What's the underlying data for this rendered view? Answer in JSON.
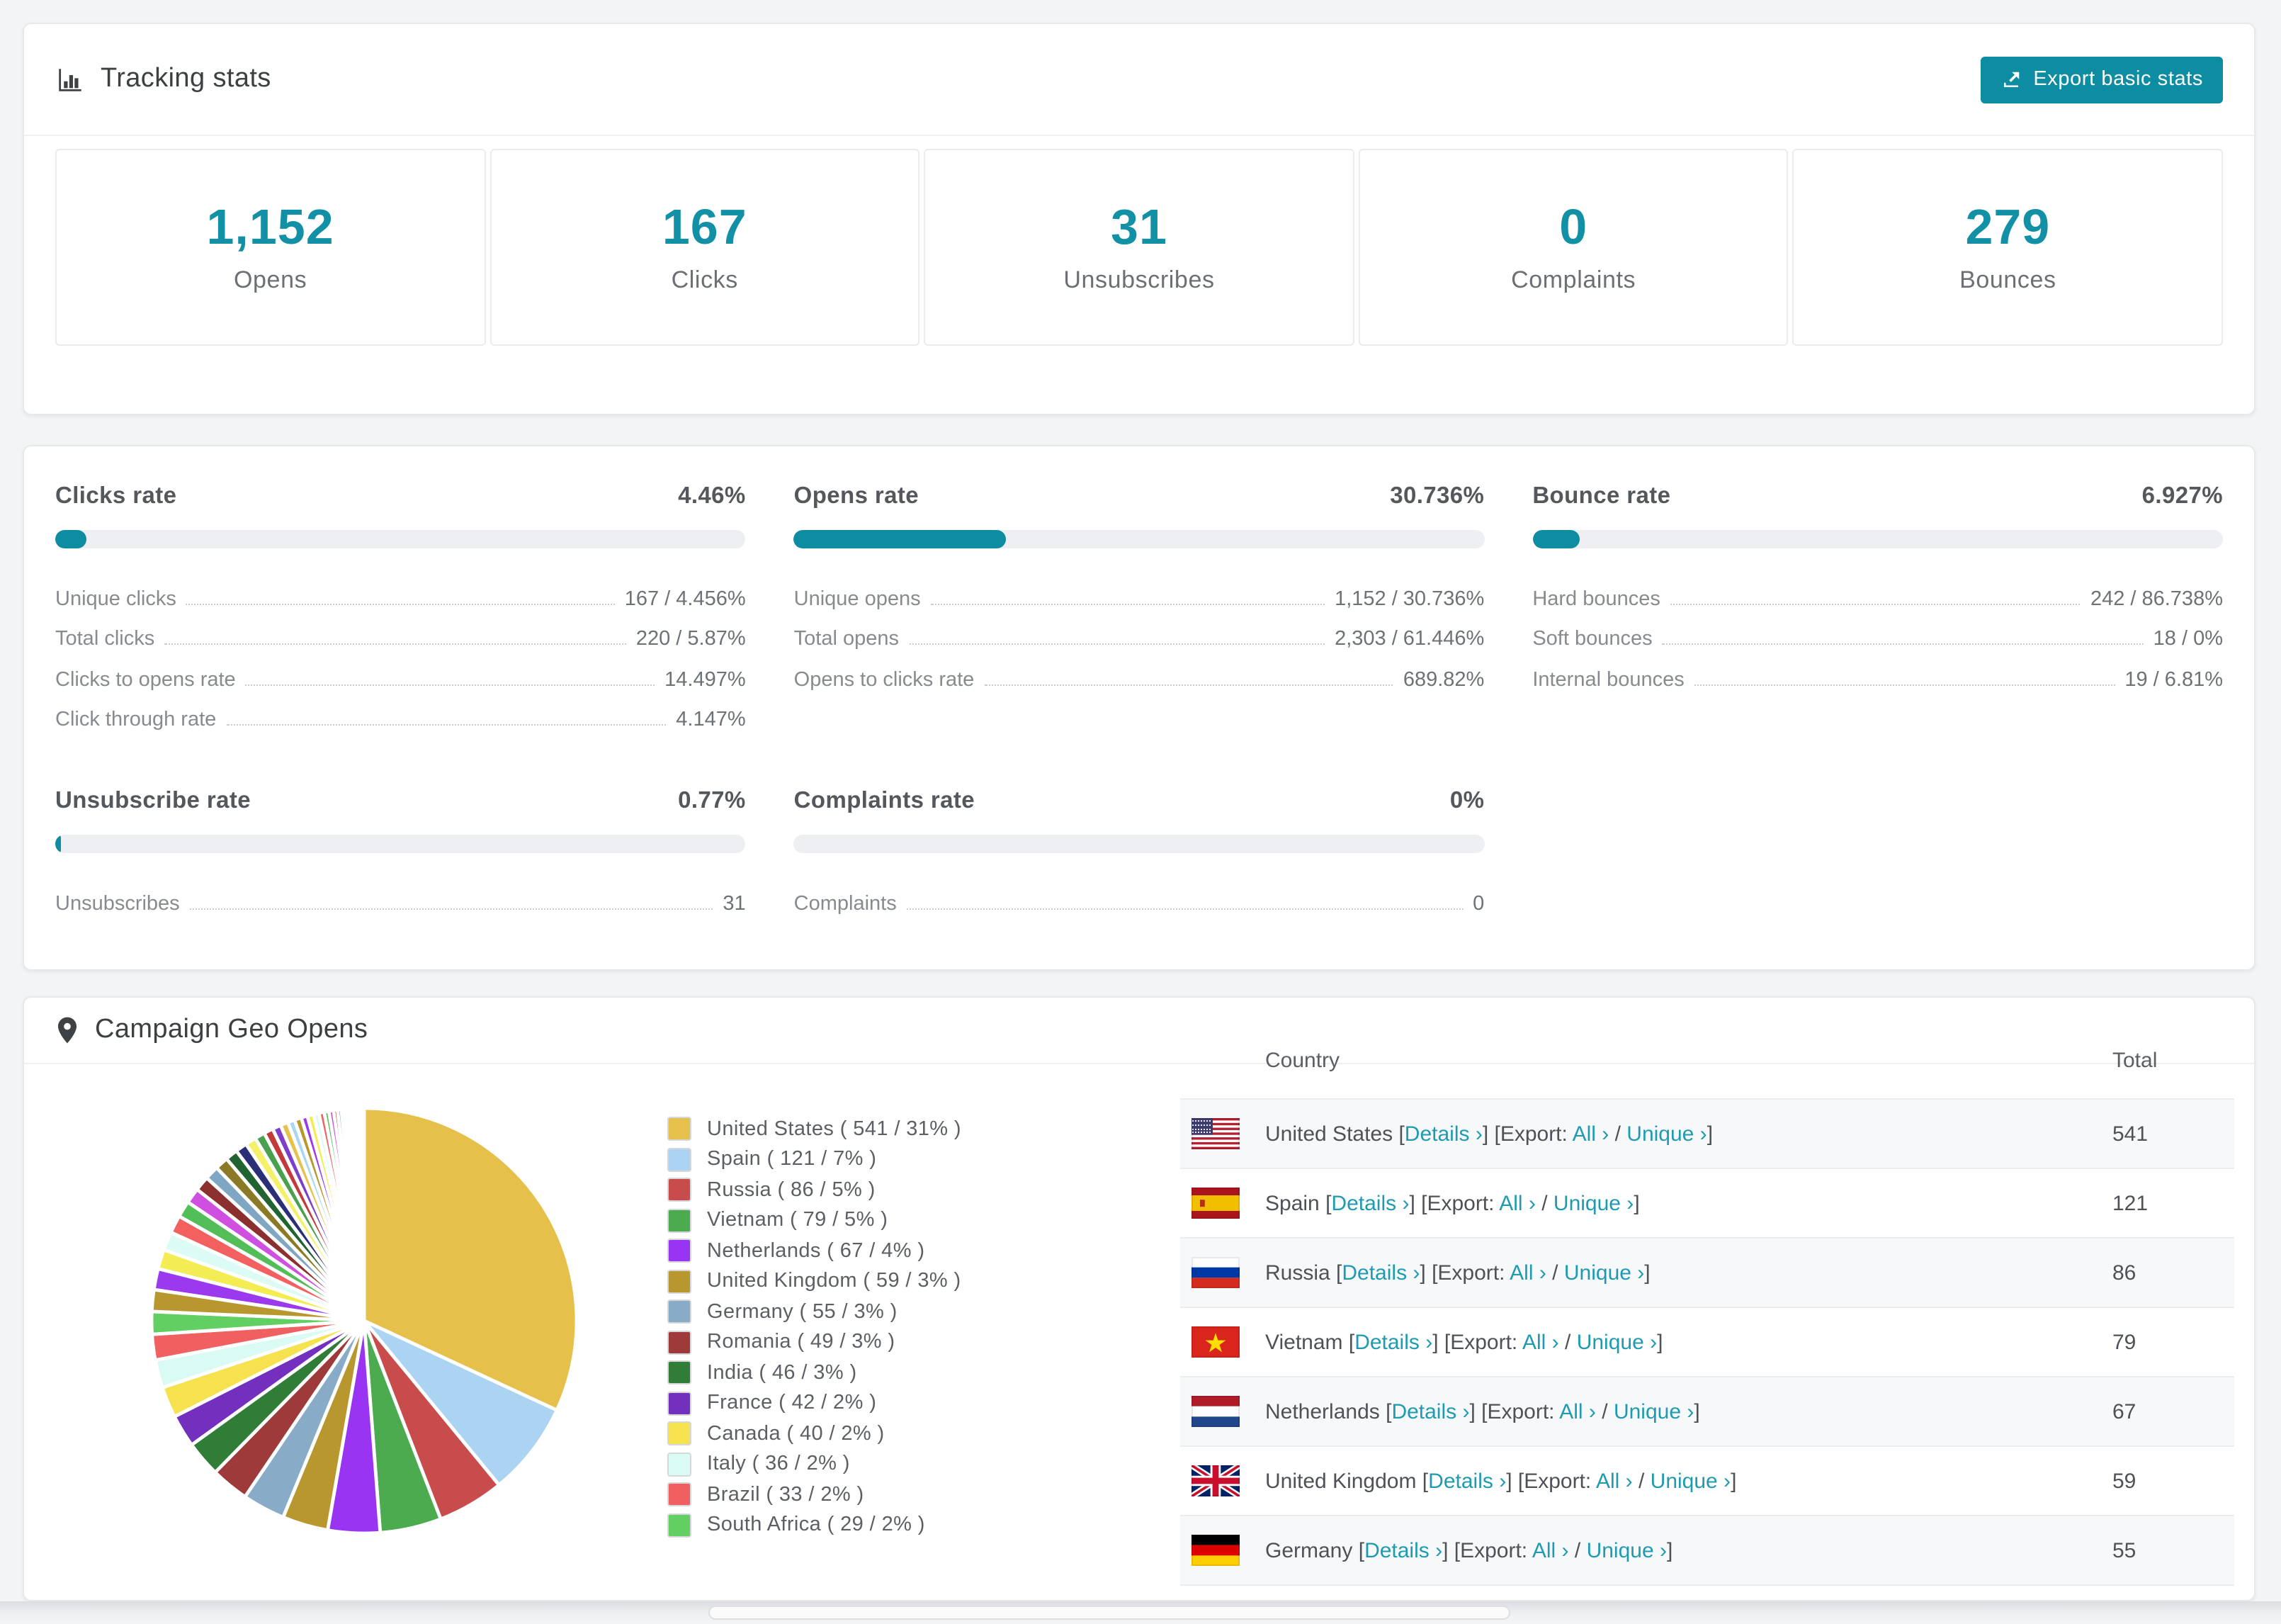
{
  "accent": "#0e8ca2",
  "link_color": "#1f9bb1",
  "tracking": {
    "title": "Tracking stats",
    "export_button": "Export basic stats",
    "stats": [
      {
        "value": "1,152",
        "label": "Opens"
      },
      {
        "value": "167",
        "label": "Clicks"
      },
      {
        "value": "31",
        "label": "Unsubscribes"
      },
      {
        "value": "0",
        "label": "Complaints"
      },
      {
        "value": "279",
        "label": "Bounces"
      }
    ]
  },
  "rate_panels": [
    {
      "title": "Clicks rate",
      "value": "4.46%",
      "percent": 4.46,
      "rows": [
        [
          "Unique clicks",
          "167 / 4.456%"
        ],
        [
          "Total clicks",
          "220 / 5.87%"
        ],
        [
          "Clicks to opens rate",
          "14.497%"
        ],
        [
          "Click through rate",
          "4.147%"
        ]
      ]
    },
    {
      "title": "Opens rate",
      "value": "30.736%",
      "percent": 30.736,
      "rows": [
        [
          "Unique opens",
          "1,152 / 30.736%"
        ],
        [
          "Total opens",
          "2,303 / 61.446%"
        ],
        [
          "Opens to clicks rate",
          "689.82%"
        ]
      ]
    },
    {
      "title": "Bounce rate",
      "value": "6.927%",
      "percent": 6.927,
      "rows": [
        [
          "Hard bounces",
          "242 / 86.738%"
        ],
        [
          "Soft bounces",
          "18 / 0%"
        ],
        [
          "Internal bounces",
          "19 / 6.81%"
        ]
      ]
    },
    {
      "title": "Unsubscribe rate",
      "value": "0.77%",
      "percent": 0.77,
      "rows": [
        [
          "Unsubscribes",
          "31"
        ]
      ]
    },
    {
      "title": "Complaints rate",
      "value": "0%",
      "percent": 0,
      "rows": [
        [
          "Complaints",
          "0"
        ]
      ]
    }
  ],
  "geo": {
    "title": "Campaign Geo Opens",
    "legend_fmt": {
      "open": " ( ",
      "slash": " / ",
      "pct": "% ",
      "close": ")"
    },
    "table": {
      "headers": [
        "Country",
        "Total"
      ],
      "fmt": {
        "lb": "[",
        "rb": "]",
        "details": "Details ›",
        "export": "Export:",
        "all": "All ›",
        "slash": " / ",
        "unique": "Unique ›"
      },
      "rows": [
        {
          "flag": "us",
          "country": "United States",
          "total": "541"
        },
        {
          "flag": "es",
          "country": "Spain",
          "total": "121"
        },
        {
          "flag": "ru",
          "country": "Russia",
          "total": "86"
        },
        {
          "flag": "vn",
          "country": "Vietnam",
          "total": "79"
        },
        {
          "flag": "nl",
          "country": "Netherlands",
          "total": "67"
        },
        {
          "flag": "gb",
          "country": "United Kingdom",
          "total": "59"
        },
        {
          "flag": "de",
          "country": "Germany",
          "total": "55"
        }
      ]
    }
  },
  "chart_data": {
    "type": "pie",
    "title": "Campaign Geo Opens",
    "legend_position": "right",
    "start_angle_deg": -90,
    "direction": "clockwise",
    "segments": [
      {
        "label": "United States",
        "value": 541,
        "pct": 31,
        "color": "#E5C04B"
      },
      {
        "label": "Spain",
        "value": 121,
        "pct": 7,
        "color": "#ABD3F2"
      },
      {
        "label": "Russia",
        "value": 86,
        "pct": 5,
        "color": "#C94C4C"
      },
      {
        "label": "Vietnam",
        "value": 79,
        "pct": 5,
        "color": "#4CAA4F"
      },
      {
        "label": "Netherlands",
        "value": 67,
        "pct": 4,
        "color": "#9934F2"
      },
      {
        "label": "United Kingdom",
        "value": 59,
        "pct": 3,
        "color": "#B9972F"
      },
      {
        "label": "Germany",
        "value": 55,
        "pct": 3,
        "color": "#88ABC8"
      },
      {
        "label": "Romania",
        "value": 49,
        "pct": 3,
        "color": "#9E3A3A"
      },
      {
        "label": "India",
        "value": 46,
        "pct": 3,
        "color": "#2F7D36"
      },
      {
        "label": "France",
        "value": 42,
        "pct": 2,
        "color": "#7330BE"
      },
      {
        "label": "Canada",
        "value": 40,
        "pct": 2,
        "color": "#F6E14E"
      },
      {
        "label": "Italy",
        "value": 36,
        "pct": 2,
        "color": "#DAFBF4"
      },
      {
        "label": "Brazil",
        "value": 33,
        "pct": 2,
        "color": "#F16060"
      },
      {
        "label": "South Africa",
        "value": 29,
        "pct": 2,
        "color": "#62CF62"
      }
    ],
    "unlabeled_tail_values": [
      28,
      27,
      25,
      24,
      23,
      21,
      20,
      19,
      18,
      17,
      16,
      15,
      14,
      13,
      12,
      11,
      10,
      9,
      9,
      8,
      8,
      7,
      7,
      6,
      6,
      5,
      5,
      4,
      4,
      3,
      3,
      3,
      2,
      2,
      2,
      2,
      1,
      1,
      1,
      1
    ],
    "tail_palette": [
      "#B9972F",
      "#9A39EE",
      "#F3EC52",
      "#DDFBF5",
      "#F26060",
      "#53BE58",
      "#CE4FE0",
      "#8C2F2F",
      "#7FA6C2",
      "#8A7A26",
      "#226332",
      "#2B2F77",
      "#F5F06A",
      "#49A14D",
      "#C23A3A",
      "#7D3FC9",
      "#E6C14C",
      "#A9D6F0"
    ]
  }
}
